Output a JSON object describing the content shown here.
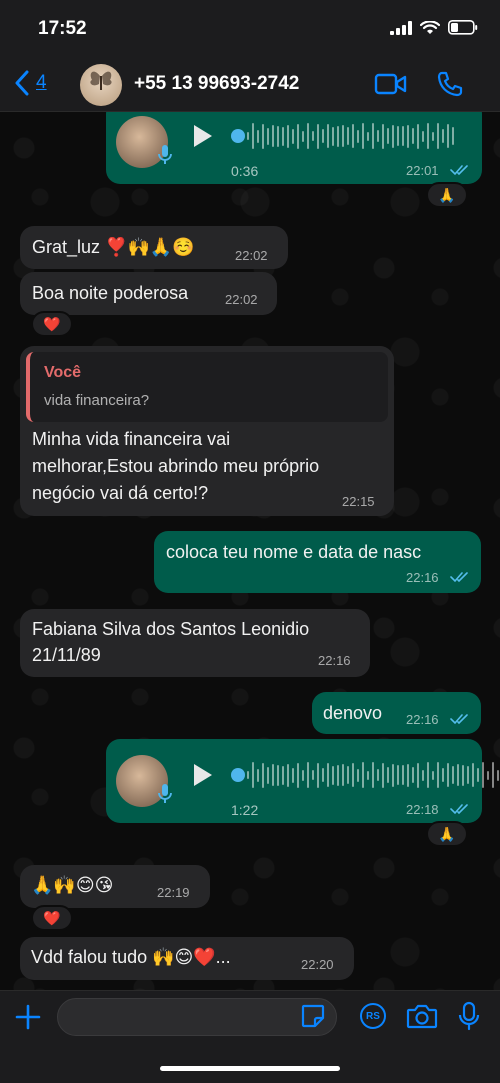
{
  "status": {
    "time": "17:52"
  },
  "header": {
    "back_count": "4",
    "contact": "+55 13 99693-2742"
  },
  "messages": {
    "m0": {
      "duration": "0:36",
      "time": "22:01",
      "reaction": "🙏"
    },
    "m1": {
      "text": "Grat_luz ❣️🙌🙏☺️",
      "time": "22:02"
    },
    "m2": {
      "text": "Boa noite poderosa",
      "time": "22:02",
      "reaction": "❤️"
    },
    "m3": {
      "quote_author": "Você",
      "quote_text": "vida financeira?",
      "line1": "Minha vida  financeira vai",
      "line2": "melhorar,Estou abrindo meu próprio",
      "line3": "negócio vai dá certo!?",
      "time": "22:15"
    },
    "m4": {
      "text": "coloca teu nome e data de nasc",
      "time": "22:16"
    },
    "m5": {
      "line1": "Fabiana Silva dos Santos Leonidio",
      "line2": "21/11/89",
      "time": "22:16"
    },
    "m6": {
      "text": "denovo",
      "time": "22:16"
    },
    "m7": {
      "duration": "1:22",
      "time": "22:18",
      "reaction": "🙏"
    },
    "m8": {
      "text": "🙏🙌😊😘",
      "time": "22:19",
      "reaction": "❤️"
    },
    "m9": {
      "text": "Vdd falou tudo 🙌😊❤️...",
      "time": "22:20"
    }
  },
  "composer": {
    "rs_label": "RS"
  },
  "colors": {
    "outgoing": "#005c4b",
    "incoming": "#262628",
    "accent": "#0a84ff",
    "read_ticks": "#53bdeb",
    "quote_author": "#e36b6b"
  }
}
